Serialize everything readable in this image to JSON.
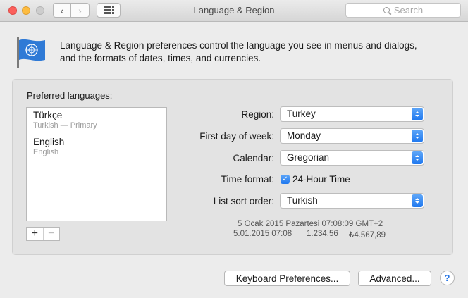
{
  "window": {
    "title": "Language & Region"
  },
  "search": {
    "placeholder": "Search"
  },
  "intro": {
    "line1": "Language & Region preferences control the language you see in menus and dialogs,",
    "line2": "and the formats of dates, times, and currencies."
  },
  "languages": {
    "label": "Preferred languages:",
    "items": [
      {
        "name": "Türkçe",
        "sub": "Turkish — Primary"
      },
      {
        "name": "English",
        "sub": "English"
      }
    ]
  },
  "fields": {
    "region": {
      "label": "Region:",
      "value": "Turkey"
    },
    "first_day": {
      "label": "First day of week:",
      "value": "Monday"
    },
    "calendar": {
      "label": "Calendar:",
      "value": "Gregorian"
    },
    "time_format": {
      "label": "Time format:",
      "checkbox_label": "24-Hour Time",
      "checked": true
    },
    "sort_order": {
      "label": "List sort order:",
      "value": "Turkish"
    }
  },
  "sample": {
    "long_date": "5 Ocak 2015 Pazartesi 07:08:09 GMT+2",
    "short_date": "5.01.2015 07:08",
    "number": "1.234,56",
    "currency": "₺4.567,89"
  },
  "buttons": {
    "add": "+",
    "remove": "−",
    "keyboard": "Keyboard Preferences...",
    "advanced": "Advanced...",
    "help": "?"
  },
  "colors": {
    "accent": "#1f78ef",
    "flag_blue": "#2f7ad6"
  }
}
